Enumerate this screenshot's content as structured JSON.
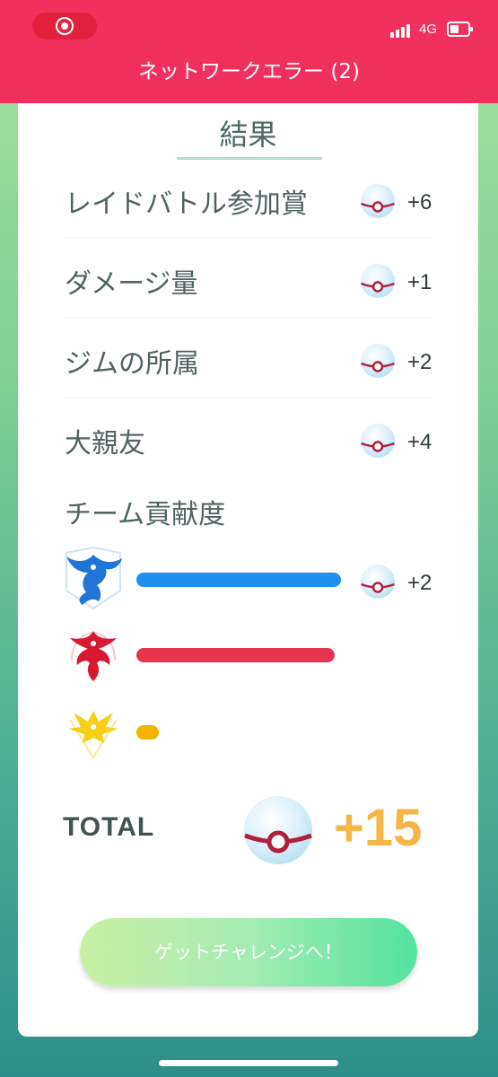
{
  "status_bar": {
    "network": "4G",
    "accent": "#f2305e"
  },
  "header": {
    "title": "ネットワークエラー (2)"
  },
  "result": {
    "title": "結果",
    "rows": [
      {
        "label": "レイドバトル参加賞",
        "value": "+6"
      },
      {
        "label": "ダメージ量",
        "value": "+1"
      },
      {
        "label": "ジムの所属",
        "value": "+2"
      },
      {
        "label": "大親友",
        "value": "+4"
      }
    ],
    "team_section_label": "チーム貢献度",
    "teams": [
      {
        "team": "mystic",
        "bar_fraction": 1.0,
        "bar_color": "#1e90f0",
        "value": "+2"
      },
      {
        "team": "valor",
        "bar_fraction": 0.97,
        "bar_color": "#e8334d",
        "value": ""
      },
      {
        "team": "instinct",
        "bar_fraction": 0.11,
        "bar_color": "#f5b400",
        "value": ""
      }
    ],
    "total_label": "TOTAL",
    "total_value": "+15"
  },
  "cta": {
    "label": "ゲットチャレンジへ！"
  },
  "icons": {
    "premier_ball": "premier-ball-icon",
    "mystic": "team-mystic-icon",
    "valor": "team-valor-icon",
    "instinct": "team-instinct-icon"
  }
}
